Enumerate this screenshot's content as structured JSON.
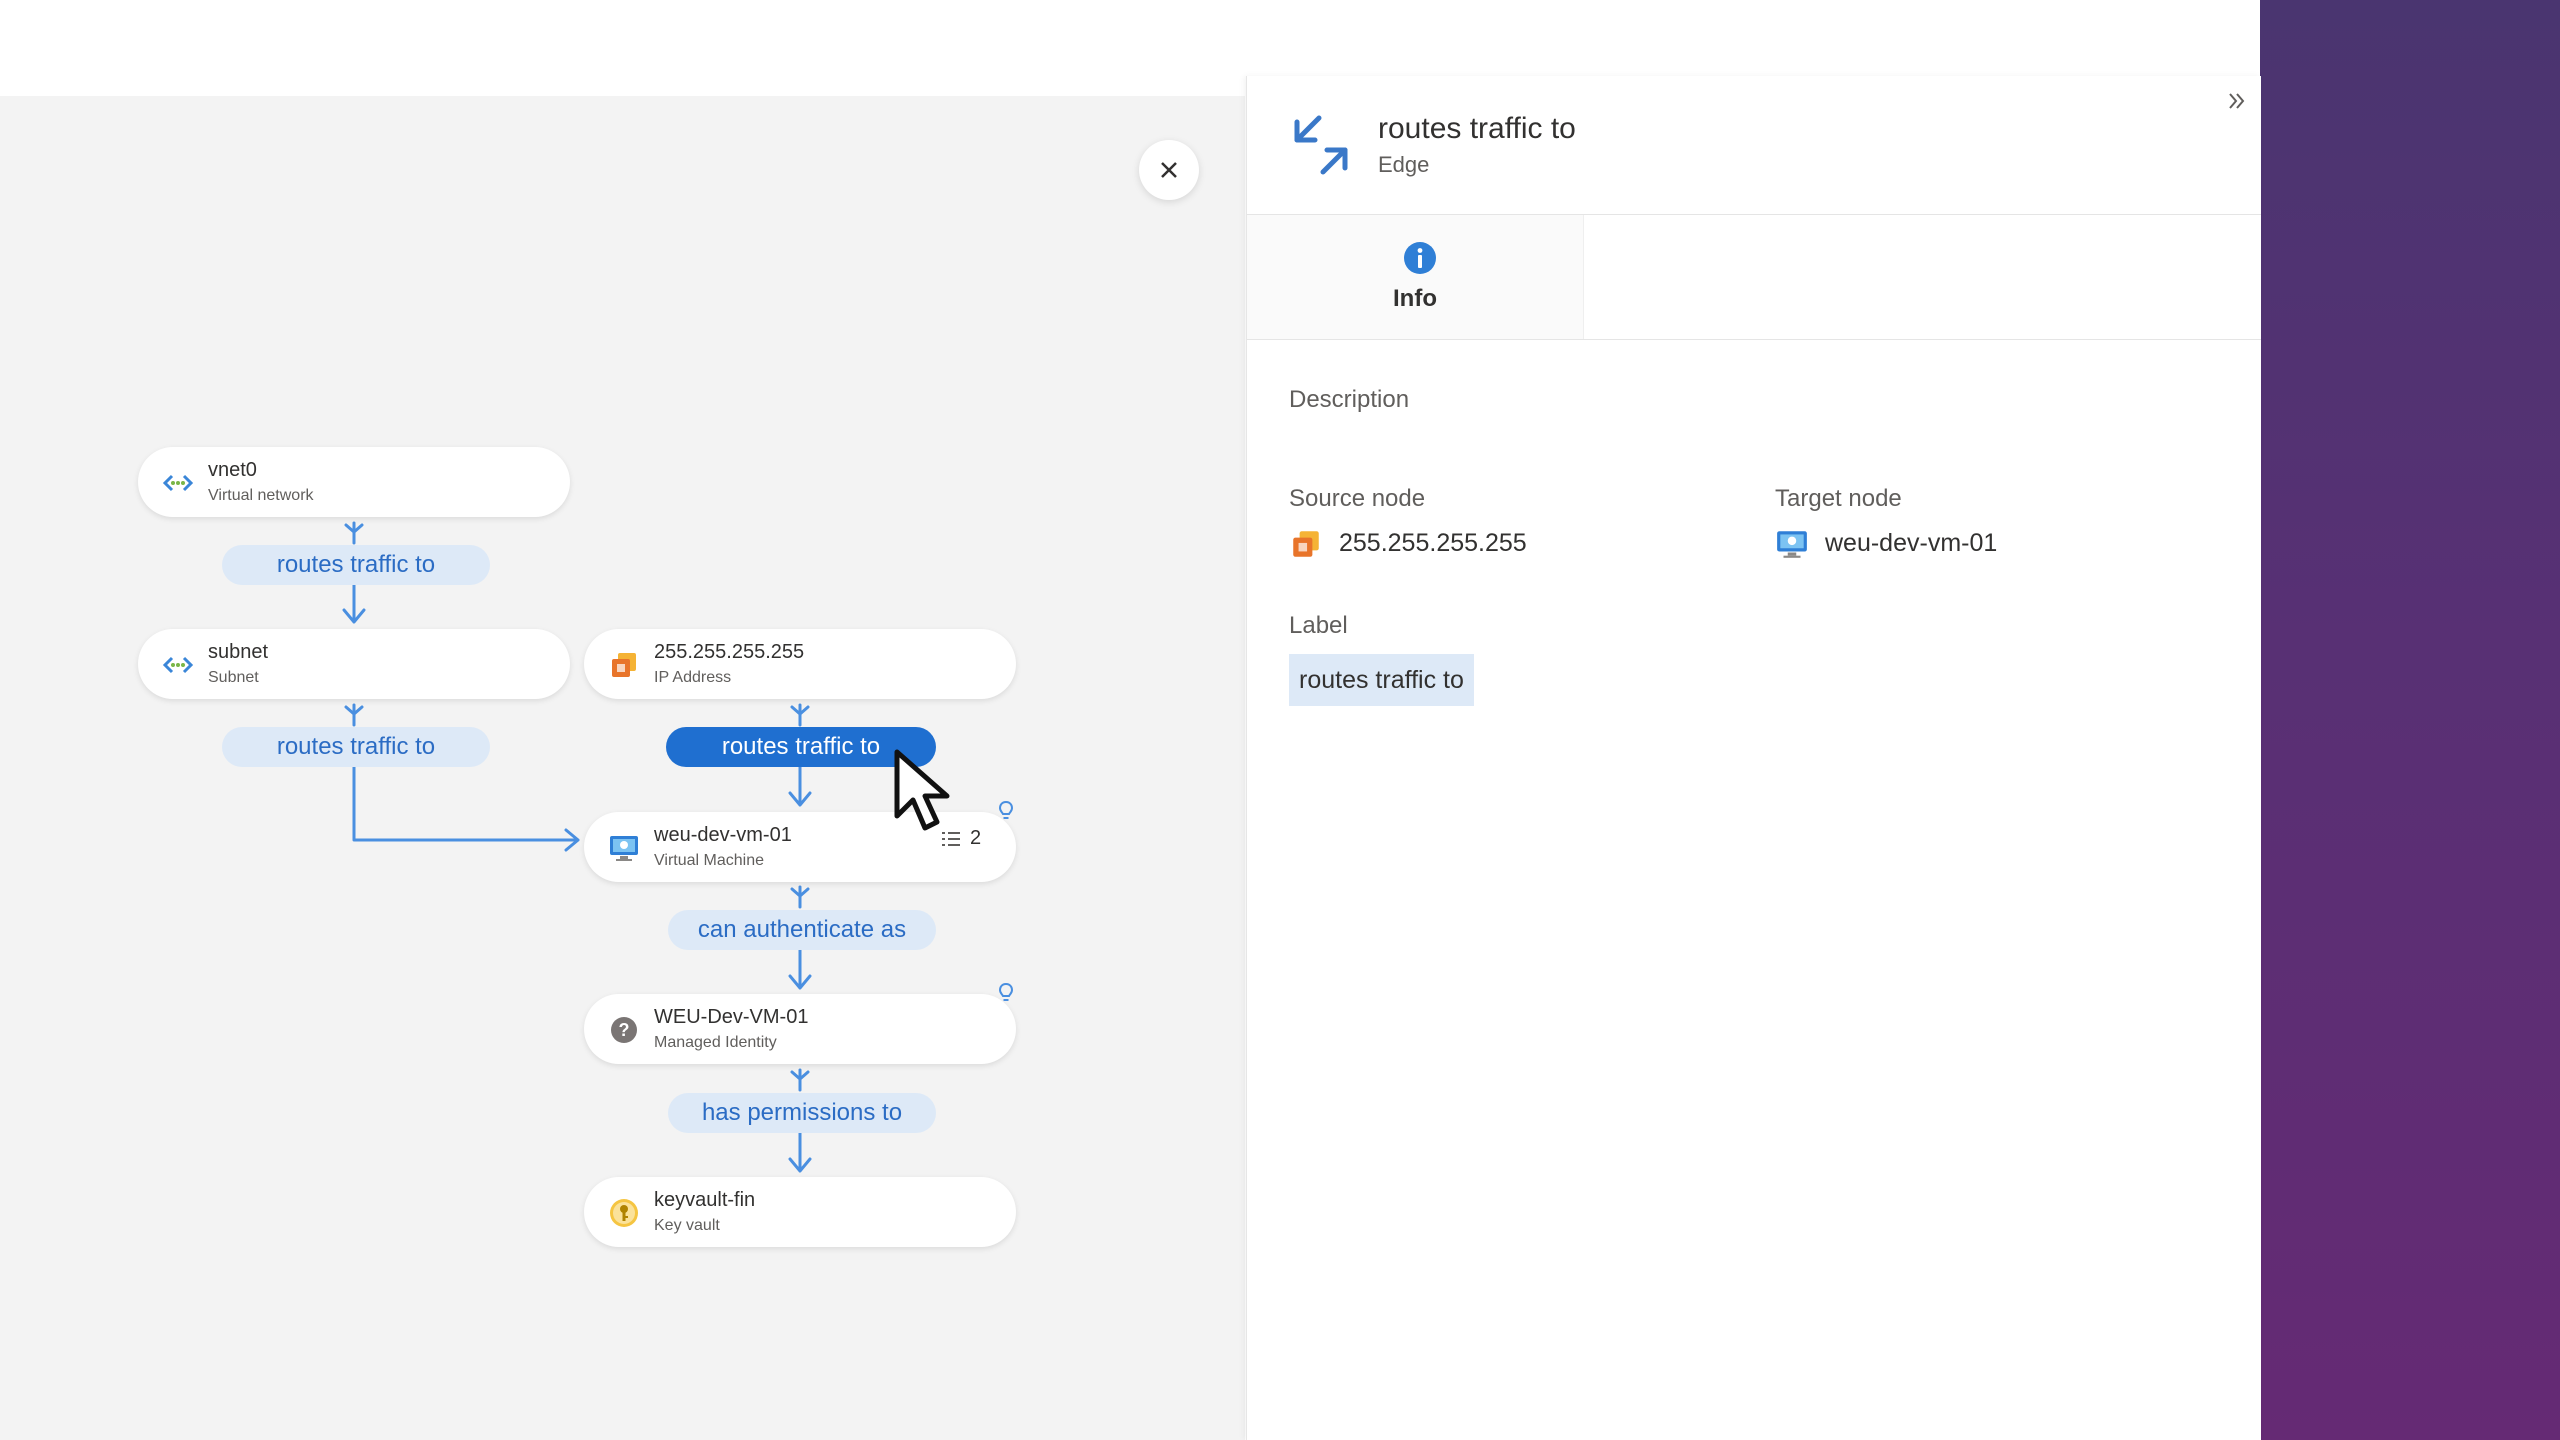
{
  "graph": {
    "nodes": [
      {
        "name": "vnet0",
        "type": "Virtual network"
      },
      {
        "name": "subnet",
        "type": "Subnet"
      },
      {
        "name": "255.255.255.255",
        "type": "IP Address"
      },
      {
        "name": "weu-dev-vm-01",
        "type": "Virtual Machine",
        "badge_count": "2"
      },
      {
        "name": "WEU-Dev-VM-01",
        "type": "Managed Identity"
      },
      {
        "name": "keyvault-fin",
        "type": "Key vault"
      }
    ],
    "edges": [
      {
        "label": "routes traffic to"
      },
      {
        "label": "routes traffic to"
      },
      {
        "label": "routes traffic to",
        "selected": true
      },
      {
        "label": "can authenticate as"
      },
      {
        "label": "has permissions to"
      }
    ]
  },
  "panel": {
    "title": "routes traffic to",
    "subtitle": "Edge",
    "tabs": [
      {
        "label": "Info",
        "icon": "info-icon",
        "active": true
      }
    ],
    "description_label": "Description",
    "source_node_label": "Source node",
    "source_node_value": "255.255.255.255",
    "target_node_label": "Target node",
    "target_node_value": "weu-dev-vm-01",
    "label_label": "Label",
    "label_value": "routes traffic to"
  },
  "colors": {
    "accent": "#1f6fd0",
    "edge_chip": "#dde9f7",
    "connector": "#4a8fe0",
    "canvas": "#f3f3f3",
    "purple": "#583074"
  }
}
